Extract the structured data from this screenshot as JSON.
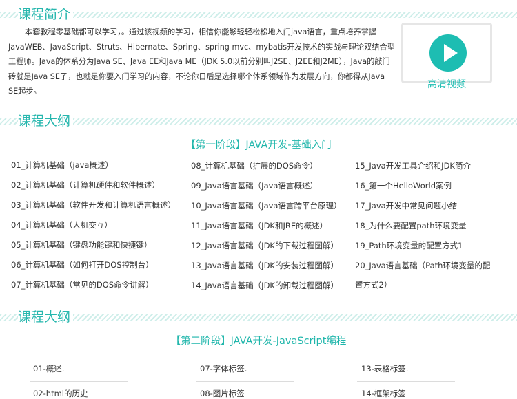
{
  "course_intro": {
    "heading": "课程简介",
    "text": "本套教程零基础都可以学习，。通过该视频的学习，相信你能够轻轻松松地入门java语言，重点培养掌握JavaWEB、JavaScript、Struts、Hibernate、Spring、spring mvc、mybatis开发技术的实战与理论双结合型工程师。Java的体系分为Java SE、Java EE和Java ME（JDK 5.0以前分别叫J2SE、J2EE和J2ME），Java的敲门砖就是Java SE了，也就是你要入门学习的内容，不论你日后是选择哪个体系领域作为发展方向，你都得从Java SE起步。"
  },
  "video": {
    "label": "高清视频",
    "icon": "play-icon",
    "accent": "#1dbdb2"
  },
  "outline1": {
    "heading": "课程大纲",
    "phase_title": "【第一阶段】JAVA开发-基础入门",
    "col1": [
      "01_计算机基础（java概述）",
      "02_计算机基础（计算机硬件和软件概述）",
      "03_计算机基础（软件开发和计算机语言概述）",
      "04_计算机基础（人机交互）",
      "05_计算机基础（键盘功能键和快捷键）",
      "06_计算机基础（如何打开DOS控制台）",
      "07_计算机基础（常见的DOS命令讲解）"
    ],
    "col2": [
      "08_计算机基础（扩展的DOS命令）",
      "09_Java语言基础（Java语言概述）",
      "10_Java语言基础（Java语言跨平台原理）",
      "11_Java语言基础（JDK和JRE的概述）",
      "12_Java语言基础（JDK的下载过程图解）",
      "13_Java语言基础（JDK的安装过程图解）",
      "14_Java语言基础（JDK的卸载过程图解）"
    ],
    "col3": [
      "15_Java开发工具介绍和JDK简介",
      "16_第一个HelloWorld案例",
      "17_Java开发中常见问题小结",
      "18_为什么要配置path环境变量",
      "19_Path环境变量的配置方式1",
      "20_Java语言基础（Path环境变量的配",
      "置方式2）"
    ]
  },
  "outline2": {
    "heading": "课程大纲",
    "phase_title": "【第二阶段】JAVA开发-JavaScript编程",
    "row1": [
      "01-概述.",
      "07-字体标签.",
      "13-表格标签."
    ],
    "row2": [
      "02-html的历史",
      "08-图片标签",
      "14-框架标签"
    ]
  }
}
